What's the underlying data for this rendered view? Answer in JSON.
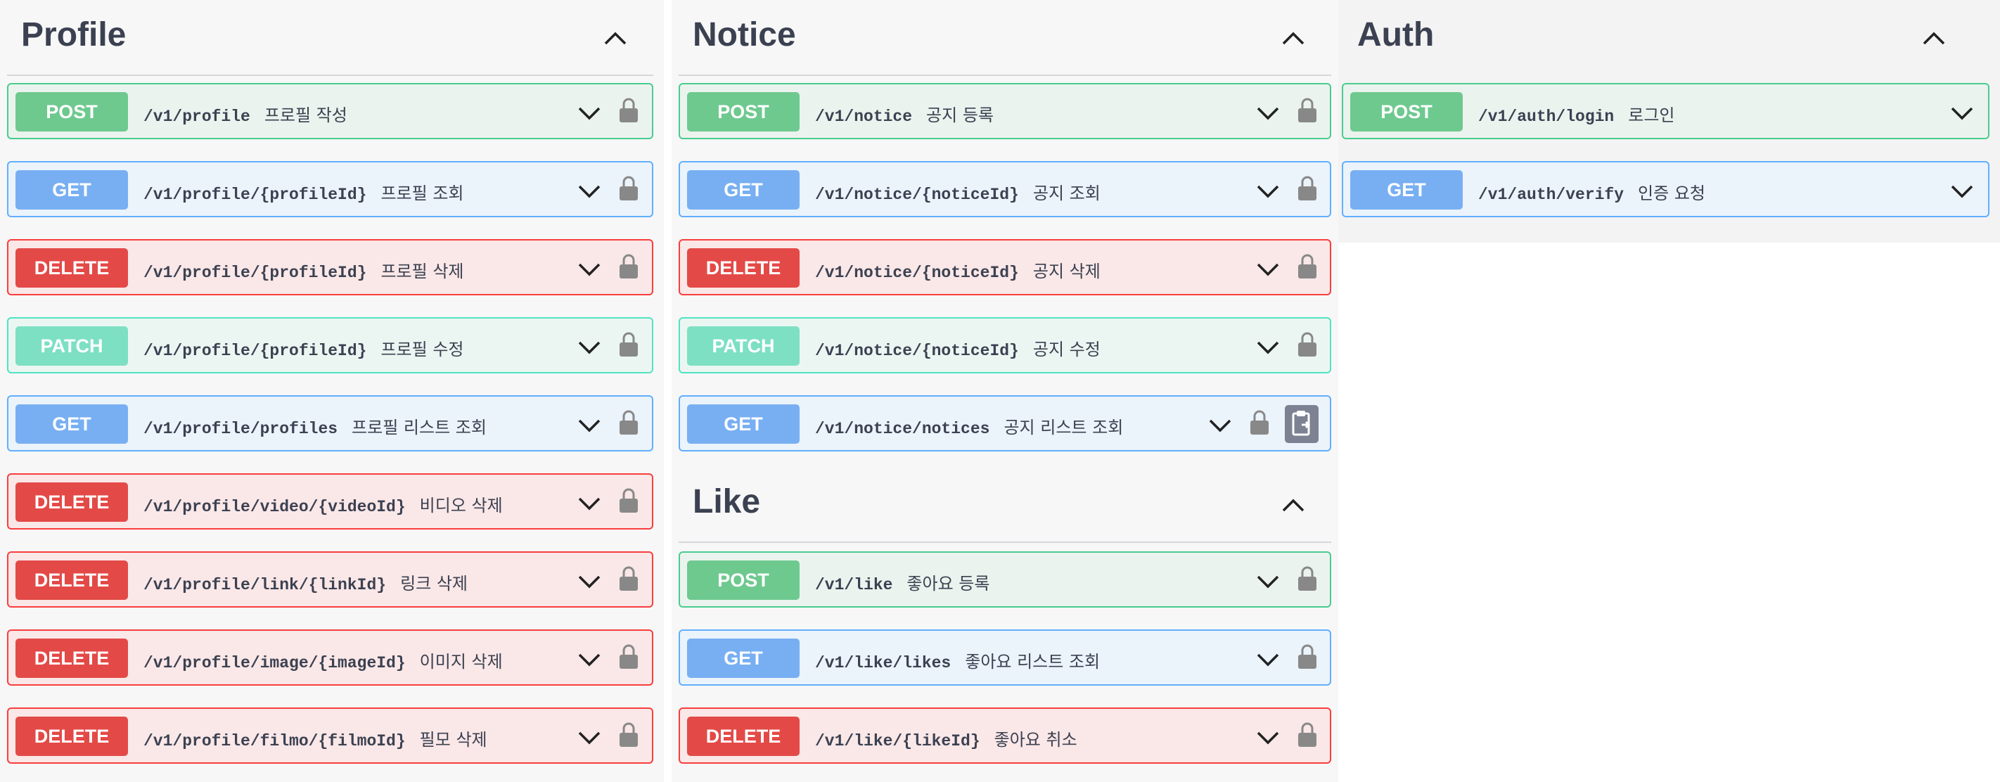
{
  "columns": {
    "profile": {
      "title": "Profile",
      "operations": [
        {
          "method": "POST",
          "path": "/v1/profile",
          "summary": "프로필 작성"
        },
        {
          "method": "GET",
          "path": "/v1/profile/{profileId}",
          "summary": "프로필 조회"
        },
        {
          "method": "DELETE",
          "path": "/v1/profile/{profileId}",
          "summary": "프로필 삭제"
        },
        {
          "method": "PATCH",
          "path": "/v1/profile/{profileId}",
          "summary": "프로필 수정"
        },
        {
          "method": "GET",
          "path": "/v1/profile/profiles",
          "summary": "프로필 리스트 조회"
        },
        {
          "method": "DELETE",
          "path": "/v1/profile/video/{videoId}",
          "summary": "비디오 삭제"
        },
        {
          "method": "DELETE",
          "path": "/v1/profile/link/{linkId}",
          "summary": "링크 삭제"
        },
        {
          "method": "DELETE",
          "path": "/v1/profile/image/{imageId}",
          "summary": "이미지 삭제"
        },
        {
          "method": "DELETE",
          "path": "/v1/profile/filmo/{filmoId}",
          "summary": "필모 삭제"
        }
      ]
    },
    "notice": {
      "title": "Notice",
      "operations": [
        {
          "method": "POST",
          "path": "/v1/notice",
          "summary": "공지 등록"
        },
        {
          "method": "GET",
          "path": "/v1/notice/{noticeId}",
          "summary": "공지 조회"
        },
        {
          "method": "DELETE",
          "path": "/v1/notice/{noticeId}",
          "summary": "공지 삭제"
        },
        {
          "method": "PATCH",
          "path": "/v1/notice/{noticeId}",
          "summary": "공지 수정"
        },
        {
          "method": "GET",
          "path": "/v1/notice/notices",
          "summary": "공지 리스트 조회"
        }
      ]
    },
    "like": {
      "title": "Like",
      "operations": [
        {
          "method": "POST",
          "path": "/v1/like",
          "summary": "좋아요 등록"
        },
        {
          "method": "GET",
          "path": "/v1/like/likes",
          "summary": "좋아요 리스트 조회"
        },
        {
          "method": "DELETE",
          "path": "/v1/like/{likeId}",
          "summary": "좋아요 취소"
        }
      ]
    },
    "auth": {
      "title": "Auth",
      "operations": [
        {
          "method": "POST",
          "path": "/v1/auth/login",
          "summary": "로그인"
        },
        {
          "method": "GET",
          "path": "/v1/auth/verify",
          "summary": "인증 요청"
        }
      ]
    }
  },
  "icons": {
    "expand": "chevron-down-icon",
    "collapse": "chevron-up-icon",
    "authorize": "lock-icon",
    "copy": "clipboard-icon"
  },
  "colors": {
    "post": "#49cc90",
    "get": "#61affe",
    "delete": "#f93e3e",
    "patch": "#50e3c2"
  }
}
